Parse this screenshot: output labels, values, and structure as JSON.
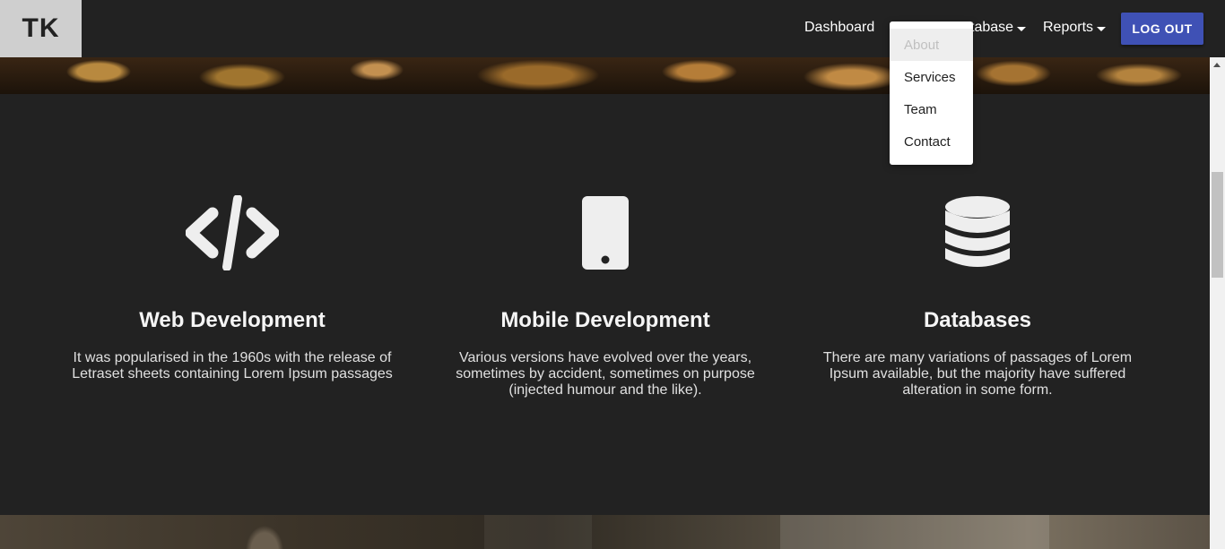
{
  "brand": {
    "logo_text": "TK"
  },
  "nav": {
    "dashboard": "Dashboard",
    "database": "Database",
    "database_visible": "tabase",
    "reports": "Reports",
    "logout": "LOG OUT"
  },
  "dropdown": {
    "items": [
      {
        "label": "About",
        "active": true
      },
      {
        "label": "Services"
      },
      {
        "label": "Team"
      },
      {
        "label": "Contact"
      }
    ]
  },
  "features": [
    {
      "icon": "code-icon",
      "title": "Web Development",
      "text": "It was popularised in the 1960s with the release of Letraset sheets containing Lorem Ipsum passages"
    },
    {
      "icon": "mobile-icon",
      "title": "Mobile Development",
      "text": "Various versions have evolved over the years, sometimes by accident, sometimes on purpose (injected humour and the like)."
    },
    {
      "icon": "database-icon",
      "title": "Databases",
      "text": "There are many variations of passages of Lorem Ipsum available, but the majority have suffered alteration in some form."
    }
  ],
  "colors": {
    "background": "#222222",
    "accent": "#3f51b5",
    "logo_bg": "#cfcfcf",
    "icon": "#eeeeee"
  }
}
